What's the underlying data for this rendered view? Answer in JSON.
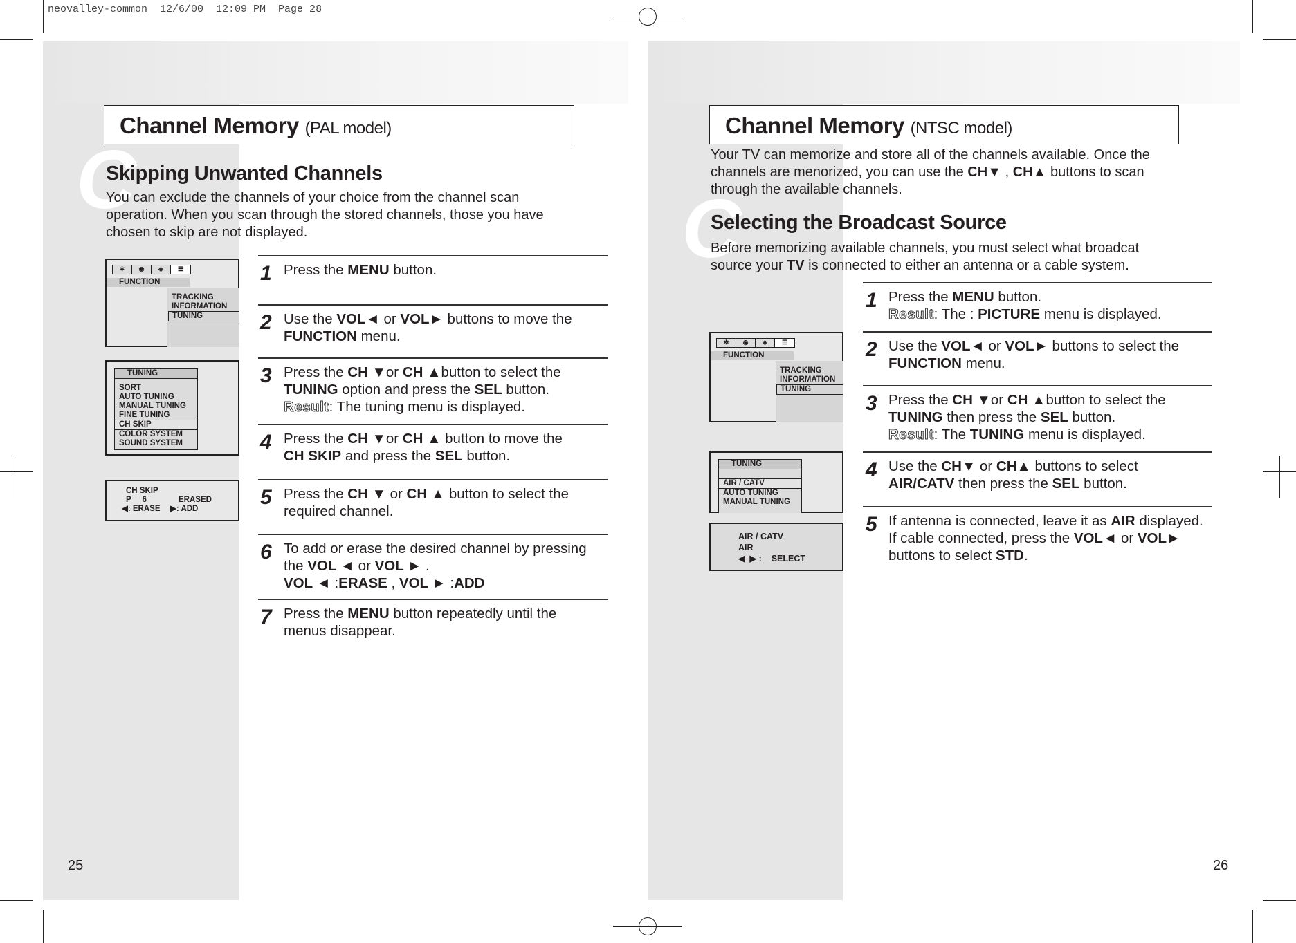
{
  "print_header": "neovalley-common  12/6/00  12:09 PM  Page 28",
  "left": {
    "title": "Channel Memory",
    "title_sub": "(PAL model)",
    "watermark": "C",
    "heading": "Skipping Unwanted Channels",
    "intro": [
      "You can exclude the channels of your choice from the channel scan",
      "operation. When you scan through the stored channels, those you have",
      "chosen to skip are not displayed."
    ],
    "osd_function": {
      "label": "FUNCTION",
      "items": [
        "TRACKING",
        "INFORMATION",
        "TUNING"
      ]
    },
    "osd_tuning": {
      "title": "TUNING",
      "items": [
        "SORT",
        "AUTO  TUNING",
        "MANUAL  TUNING",
        "FINE TUNING",
        "CH  SKIP",
        "COLOR  SYSTEM",
        "SOUND SYSTEM"
      ]
    },
    "osd_skip": {
      "l1": "CH  SKIP",
      "l2a": "P     6",
      "l2b": "ERASED",
      "l3a": "◀: ERASE",
      "l3b": "▶: ADD"
    },
    "steps": [
      {
        "n": "1",
        "lines": [
          [
            {
              "t": "Press the "
            },
            {
              "t": "MENU",
              "b": 1
            },
            {
              "t": " button."
            }
          ]
        ]
      },
      {
        "n": "2",
        "lines": [
          [
            {
              "t": "Use the "
            },
            {
              "t": "VOL◄",
              "b": 1
            },
            {
              "t": " or "
            },
            {
              "t": "VOL►",
              "b": 1
            },
            {
              "t": " buttons to move the"
            }
          ],
          [
            {
              "t": "FUNCTION",
              "b": 1
            },
            {
              "t": " menu."
            }
          ]
        ]
      },
      {
        "n": "3",
        "lines": [
          [
            {
              "t": "Press the "
            },
            {
              "t": "CH ▼",
              "b": 1
            },
            {
              "t": "or "
            },
            {
              "t": "CH ▲",
              "b": 1
            },
            {
              "t": "button to select the"
            }
          ],
          [
            {
              "t": "TUNING",
              "b": 1
            },
            {
              "t": " option and press the "
            },
            {
              "t": "SEL",
              "b": 1
            },
            {
              "t": " button."
            }
          ],
          [
            {
              "t": "Result",
              "r": 1
            },
            {
              "t": ": The tuning menu is displayed."
            }
          ]
        ]
      },
      {
        "n": "4",
        "lines": [
          [
            {
              "t": "Press the "
            },
            {
              "t": "CH ▼",
              "b": 1
            },
            {
              "t": "or "
            },
            {
              "t": "CH ▲",
              "b": 1
            },
            {
              "t": " button to move the"
            }
          ],
          [
            {
              "t": "CH SKIP",
              "b": 1
            },
            {
              "t": " and press the "
            },
            {
              "t": "SEL",
              "b": 1
            },
            {
              "t": " button."
            }
          ]
        ]
      },
      {
        "n": "5",
        "lines": [
          [
            {
              "t": "Press the "
            },
            {
              "t": "CH ▼",
              "b": 1
            },
            {
              "t": " or "
            },
            {
              "t": "CH ▲",
              "b": 1
            },
            {
              "t": " button to select the"
            }
          ],
          [
            {
              "t": "required channel."
            }
          ]
        ]
      },
      {
        "n": "6",
        "lines": [
          [
            {
              "t": "To add or erase the desired channel by pressing"
            }
          ],
          [
            {
              "t": "the "
            },
            {
              "t": "VOL ◄",
              "b": 1
            },
            {
              "t": " or "
            },
            {
              "t": "VOL ►",
              "b": 1
            },
            {
              "t": " ."
            }
          ],
          [
            {
              "t": "VOL ◄",
              "b": 1
            },
            {
              "t": " :"
            },
            {
              "t": "ERASE",
              "b": 1
            },
            {
              "t": " , "
            },
            {
              "t": "VOL ►",
              "b": 1
            },
            {
              "t": " :"
            },
            {
              "t": "ADD",
              "b": 1
            }
          ]
        ]
      },
      {
        "n": "7",
        "lines": [
          [
            {
              "t": "Press the "
            },
            {
              "t": "MENU",
              "b": 1
            },
            {
              "t": " button repeatedly until the"
            }
          ],
          [
            {
              "t": "menus disappear."
            }
          ]
        ]
      }
    ],
    "page_number": "25"
  },
  "right": {
    "title": "Channel Memory",
    "title_sub": "(NTSC model)",
    "watermark": "C",
    "intro": [
      [
        {
          "t": "Your TV can memorize and store all of the channels available. Once the"
        }
      ],
      [
        {
          "t": "channels are menorized, you can use the "
        },
        {
          "t": "CH▼",
          "b": 1
        },
        {
          "t": " , "
        },
        {
          "t": "CH▲",
          "b": 1
        },
        {
          "t": " buttons to scan"
        }
      ],
      [
        {
          "t": "through the available channels."
        }
      ]
    ],
    "heading": "Selecting the Broadcast Source",
    "intro2": [
      [
        {
          "t": "Before memorizing available channels, you must select what broadcat"
        }
      ],
      [
        {
          "t": "source your "
        },
        {
          "t": "TV",
          "b": 1
        },
        {
          "t": " is connected to either an antenna or a cable system."
        }
      ]
    ],
    "osd_function": {
      "label": "FUNCTION",
      "items": [
        "TRACKING",
        "INFORMATION",
        "TUNING"
      ]
    },
    "osd_tuning": {
      "title": "TUNING",
      "items": [
        "AIR / CATV",
        "AUTO  TUNING",
        "MANUAL  TUNING"
      ]
    },
    "osd_air": {
      "l1": "AIR / CATV",
      "l2": "AIR",
      "l3": "◀  ▶ :    SELECT"
    },
    "steps": [
      {
        "n": "1",
        "lines": [
          [
            {
              "t": "Press the "
            },
            {
              "t": "MENU",
              "b": 1
            },
            {
              "t": " button."
            }
          ],
          [
            {
              "t": "Result",
              "r": 1
            },
            {
              "t": ": The : "
            },
            {
              "t": "PICTURE",
              "b": 1
            },
            {
              "t": " menu is displayed."
            }
          ]
        ]
      },
      {
        "n": "2",
        "lines": [
          [
            {
              "t": "Use the "
            },
            {
              "t": "VOL◄",
              "b": 1
            },
            {
              "t": " or "
            },
            {
              "t": "VOL►",
              "b": 1
            },
            {
              "t": " buttons to select the"
            }
          ],
          [
            {
              "t": "FUNCTION",
              "b": 1
            },
            {
              "t": " menu."
            }
          ]
        ]
      },
      {
        "n": "3",
        "lines": [
          [
            {
              "t": "Press the "
            },
            {
              "t": "CH ▼",
              "b": 1
            },
            {
              "t": "or "
            },
            {
              "t": "CH ▲",
              "b": 1
            },
            {
              "t": "button to select the"
            }
          ],
          [
            {
              "t": "TUNING",
              "b": 1
            },
            {
              "t": " then press the "
            },
            {
              "t": "SEL",
              "b": 1
            },
            {
              "t": " button."
            }
          ],
          [
            {
              "t": "Result",
              "r": 1
            },
            {
              "t": ": The "
            },
            {
              "t": "TUNING",
              "b": 1
            },
            {
              "t": " menu is displayed."
            }
          ]
        ]
      },
      {
        "n": "4",
        "lines": [
          [
            {
              "t": "Use the "
            },
            {
              "t": "CH▼",
              "b": 1
            },
            {
              "t": " or "
            },
            {
              "t": "CH▲",
              "b": 1
            },
            {
              "t": " buttons to select"
            }
          ],
          [
            {
              "t": "AIR/CATV",
              "b": 1
            },
            {
              "t": " then press the "
            },
            {
              "t": "SEL",
              "b": 1
            },
            {
              "t": " button."
            }
          ]
        ]
      },
      {
        "n": "5",
        "lines": [
          [
            {
              "t": "If antenna is connected, leave it as "
            },
            {
              "t": "AIR",
              "b": 1
            },
            {
              "t": " displayed."
            }
          ],
          [
            {
              "t": "If cable connected, press the "
            },
            {
              "t": "VOL◄",
              "b": 1
            },
            {
              "t": " or "
            },
            {
              "t": "VOL►",
              "b": 1
            }
          ],
          [
            {
              "t": "buttons to select "
            },
            {
              "t": "STD",
              "b": 1
            },
            {
              "t": "."
            }
          ]
        ]
      }
    ],
    "page_number": "26"
  }
}
